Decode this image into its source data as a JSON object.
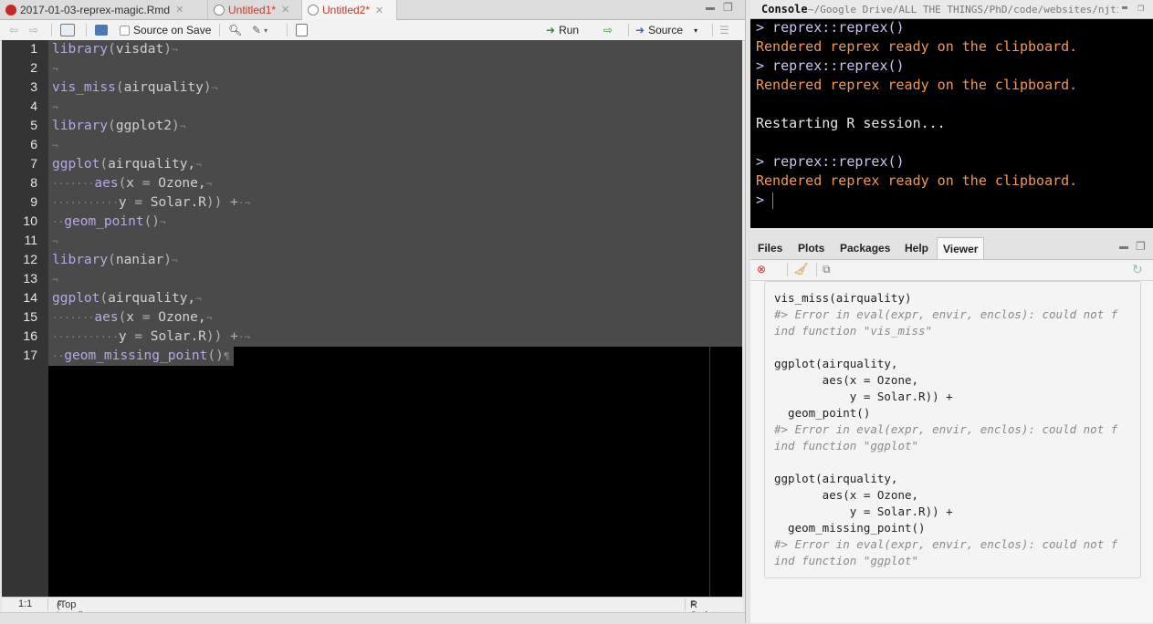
{
  "editor": {
    "tabs": [
      {
        "label": "2017-01-03-reprex-magic.Rmd",
        "modified": false
      },
      {
        "label": "Untitled1*",
        "modified": true
      },
      {
        "label": "Untitled2*",
        "modified": true
      }
    ],
    "toolbar": {
      "source_on_save": "Source on Save",
      "run": "Run",
      "source": "Source"
    },
    "line_numbers": [
      "1",
      "2",
      "3",
      "4",
      "5",
      "6",
      "7",
      "8",
      "9",
      "10",
      "11",
      "12",
      "13",
      "14",
      "15",
      "16",
      "17"
    ],
    "code_lines": [
      "library(visdat)",
      "",
      "vis_miss(airquality)",
      "",
      "library(ggplot2)",
      "",
      "ggplot(airquality,",
      "       aes(x = Ozone,",
      "           y = Solar.R)) +",
      "  geom_point()",
      "",
      "library(naniar)",
      "",
      "ggplot(airquality,",
      "       aes(x = Ozone,",
      "           y = Solar.R)) +",
      "  geom_missing_point()"
    ],
    "status": {
      "position": "1:1",
      "scope": "(Top Level)",
      "file_type": "R Script"
    }
  },
  "console": {
    "title": "Console",
    "path": "~/Google Drive/ALL THE THINGS/PhD/code/websites/njtie",
    "lines": [
      {
        "kind": "prompt",
        "text": "> reprex::reprex()"
      },
      {
        "kind": "out",
        "text": "Rendered reprex ready on the clipboard."
      },
      {
        "kind": "prompt",
        "text": "> reprex::reprex()"
      },
      {
        "kind": "out",
        "text": "Rendered reprex ready on the clipboard."
      },
      {
        "kind": "plain",
        "text": ""
      },
      {
        "kind": "plain",
        "text": "Restarting R session..."
      },
      {
        "kind": "plain",
        "text": ""
      },
      {
        "kind": "prompt",
        "text": "> reprex::reprex()"
      },
      {
        "kind": "out",
        "text": "Rendered reprex ready on the clipboard."
      },
      {
        "kind": "prompt",
        "text": "> "
      }
    ]
  },
  "viewer": {
    "tabs": [
      "Files",
      "Plots",
      "Packages",
      "Help",
      "Viewer"
    ],
    "active_tab": "Viewer",
    "lines": [
      {
        "kind": "code",
        "text": "vis_miss(airquality)"
      },
      {
        "kind": "comment",
        "text": "#> Error in eval(expr, envir, enclos): could not f"
      },
      {
        "kind": "comment",
        "text": "ind function \"vis_miss\""
      },
      {
        "kind": "code",
        "text": ""
      },
      {
        "kind": "code",
        "text": "ggplot(airquality,"
      },
      {
        "kind": "code",
        "text": "       aes(x = Ozone,"
      },
      {
        "kind": "code",
        "text": "           y = Solar.R)) +"
      },
      {
        "kind": "code",
        "text": "  geom_point()"
      },
      {
        "kind": "comment",
        "text": "#> Error in eval(expr, envir, enclos): could not f"
      },
      {
        "kind": "comment",
        "text": "ind function \"ggplot\""
      },
      {
        "kind": "code",
        "text": ""
      },
      {
        "kind": "code",
        "text": "ggplot(airquality,"
      },
      {
        "kind": "code",
        "text": "       aes(x = Ozone,"
      },
      {
        "kind": "code",
        "text": "           y = Solar.R)) +"
      },
      {
        "kind": "code",
        "text": "  geom_missing_point()"
      },
      {
        "kind": "comment",
        "text": "#> Error in eval(expr, envir, enclos): could not f"
      },
      {
        "kind": "comment",
        "text": "ind function \"ggplot\""
      }
    ]
  },
  "colors": {
    "console_output": "#ef9a52",
    "console_prompt": "#cfc3f0",
    "function_name": "#b9a7e6",
    "modified_tab": "#c0392b"
  }
}
